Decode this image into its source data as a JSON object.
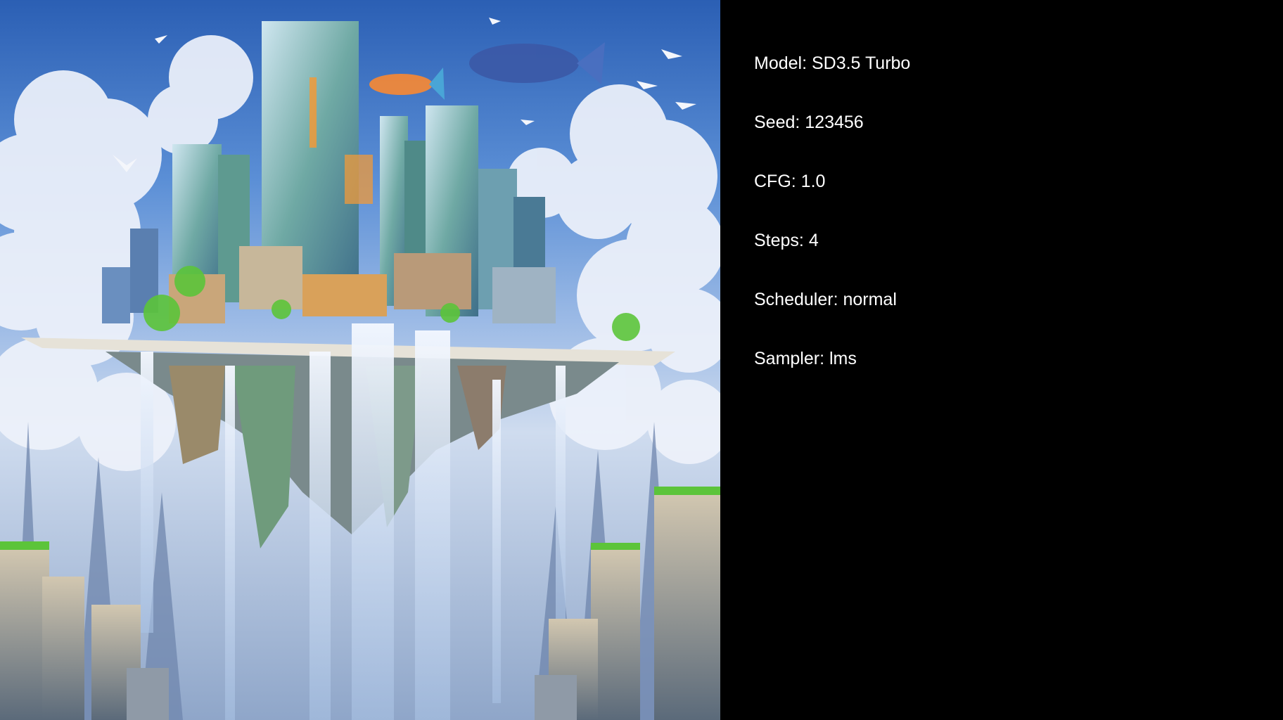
{
  "image": {
    "icon": "floating-city-artwork",
    "palette": {
      "sky_top": "#2b5fb4",
      "sky_mid": "#9dbbe6",
      "cloud": "#eef2fb",
      "building": "#7fb8b0",
      "glow": "#f09a3a",
      "waterfall": "#e4eefa",
      "moss": "#5cc43a"
    }
  },
  "params": [
    "Model: SD3.5 Turbo",
    "Seed: 123456",
    "CFG: 1.0",
    "Steps: 4",
    "Scheduler: normal",
    "Sampler: lms"
  ]
}
